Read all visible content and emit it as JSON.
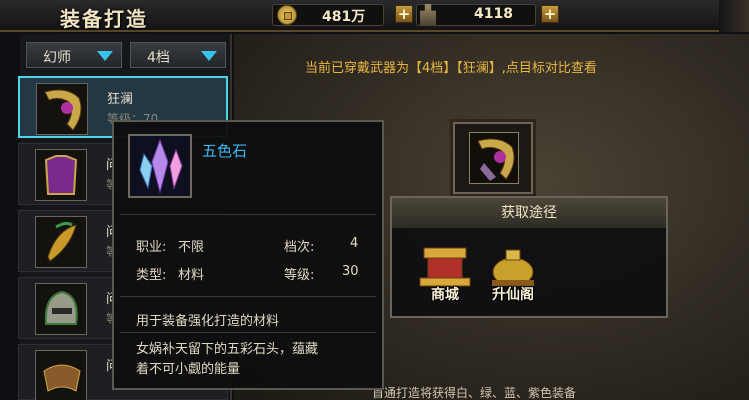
{
  "header": {
    "title": "装备打造",
    "gold": "481万",
    "ingot": "4118"
  },
  "filters": {
    "class": "幻师",
    "tier": "4档"
  },
  "items": [
    {
      "name": "狂澜",
      "sub": "等级：70"
    },
    {
      "name": "问",
      "sub": "等"
    },
    {
      "name": "问",
      "sub": "等"
    },
    {
      "name": "问",
      "sub": "等"
    },
    {
      "name": "问",
      "sub": ""
    }
  ],
  "notice": "当前已穿戴武器为【4档】【狂澜】,点目标对比查看",
  "tooltip": {
    "name": "五色石",
    "job_label": "职业:",
    "job_value": "不限",
    "tier_label": "档次:",
    "tier_value": "4",
    "type_label": "类型:",
    "type_value": "材料",
    "level_label": "等级:",
    "level_value": "30",
    "usage": "用于装备强化打造的材料",
    "desc_line1": "女娲补天留下的五彩石头，蕴藏",
    "desc_line2": "着不可小觑的能量"
  },
  "source_panel": {
    "title": "获取途径",
    "options": [
      {
        "label": "商城"
      },
      {
        "label": "升仙阁"
      }
    ]
  },
  "bottom_text": "首通打造将获得白、绿、蓝、紫色装备",
  "colors": {
    "accent_cyan": "#4fd6e6",
    "name_blue": "#3fb6f0",
    "notice_gold": "#e9b640"
  }
}
